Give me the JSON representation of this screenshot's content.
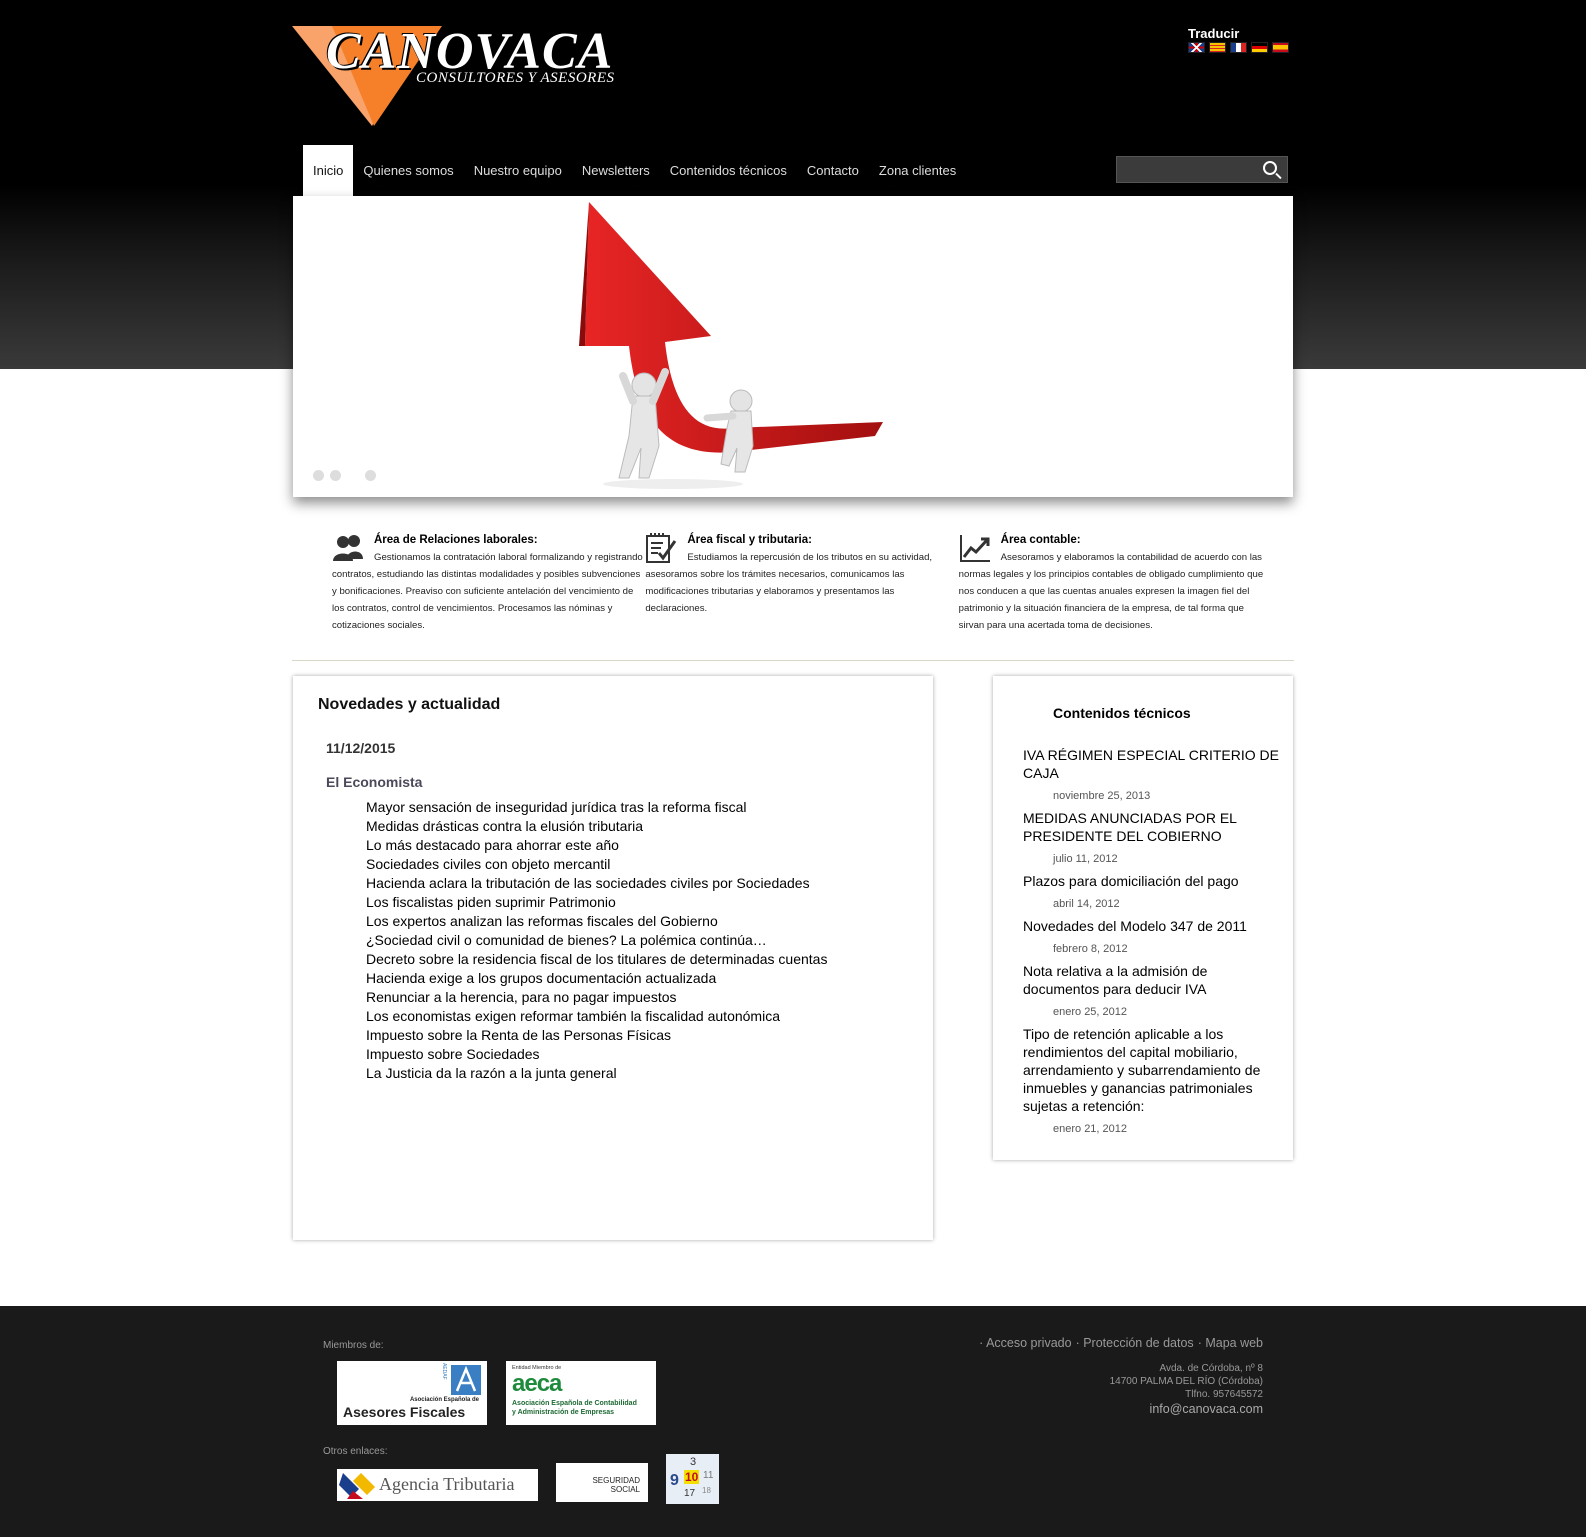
{
  "brand": {
    "name": "CANOVACA",
    "tagline": "CONSULTORES Y ASESORES",
    "accent": "#f6802a"
  },
  "translate": {
    "label": "Traducir",
    "flags": [
      "english-flag-icon",
      "catalan-flag-icon",
      "french-flag-icon",
      "german-flag-icon",
      "spanish-flag-icon"
    ]
  },
  "nav": [
    "Inicio",
    "Quienes somos",
    "Nuestro equipo",
    "Newsletters",
    "Contenidos técnicos",
    "Contacto",
    "Zona clientes"
  ],
  "search": {
    "placeholder": "",
    "value": ""
  },
  "slider": {
    "image": "red-rising-arrow-with-figures",
    "arrow_color": "#d11b1b",
    "dots": 3
  },
  "areas": [
    {
      "title": "Área de Relaciones laborales:",
      "icon": "people-icon",
      "text": "Gestionamos la contratación laboral formalizando y registrando contratos, estudiando las distintas modalidades y posibles subvenciones y bonificaciones. Preaviso con suficiente antelación del vencimiento de los contratos, control de vencimientos. Procesamos las nóminas y cotizaciones sociales."
    },
    {
      "title": "Área fiscal y tributaria:",
      "icon": "checklist-icon",
      "text": "Estudiamos la repercusión de los tributos en su actividad, asesoramos sobre los trámites necesarios, comunicamos las modificaciones tributarias y elaboramos y presentamos las declaraciones."
    },
    {
      "title": "Área contable:",
      "icon": "growth-chart-icon",
      "text": "Asesoramos y elaboramos la contabilidad de acuerdo con las normas legales y los principios contables de obligado cumplimiento que nos conducen a que las cuentas anuales expresen la imagen fiel del patrimonio y la situación financiera de la empresa, de tal forma que sirvan para una acertada toma de decisiones."
    }
  ],
  "news": {
    "title": "Novedades y actualidad",
    "date": "11/12/2015",
    "source": "El Economista",
    "items": [
      "Mayor sensación de inseguridad jurídica tras la reforma fiscal",
      "Medidas drásticas contra la elusión tributaria",
      "Lo más destacado para ahorrar este año",
      "Sociedades civiles con objeto mercantil",
      "Hacienda aclara la tributación de las sociedades civiles por Sociedades",
      "Los fiscalistas piden suprimir Patrimonio",
      "Los expertos analizan las reformas fiscales del Gobierno",
      "¿Sociedad civil o comunidad de bienes? La polémica continúa…",
      "Decreto sobre la residencia fiscal de los titulares de determinadas cuentas",
      "Hacienda exige a los grupos documentación actualizada",
      "Renunciar a la herencia, para no pagar impuestos",
      "Los economistas exigen reformar también la fiscalidad autonómica",
      "Impuesto sobre la Renta de las Personas Físicas",
      "Impuesto sobre Sociedades",
      "La Justicia da la razón a la junta general"
    ]
  },
  "technical": {
    "title": "Contenidos técnicos",
    "items": [
      {
        "title": "IVA RÉGIMEN ESPECIAL CRITERIO DE CAJA",
        "date": "noviembre 25, 2013"
      },
      {
        "title": "MEDIDAS ANUNCIADAS POR EL PRESIDENTE DEL COBIERNO",
        "date": "julio 11, 2012"
      },
      {
        "title": "Plazos para domiciliación del pago",
        "date": "abril 14, 2012"
      },
      {
        "title": "Novedades del Modelo 347 de 2011",
        "date": "febrero 8, 2012"
      },
      {
        "title": "Nota relativa a la admisión de documentos para deducir IVA",
        "date": "enero 25, 2012"
      },
      {
        "title": "Tipo de retención aplicable a los rendimientos del capital mobiliario, arrendamiento y subarrendamiento de inmuebles y ganancias patrimoniales sujetas a retención:",
        "date": "enero 21, 2012"
      }
    ]
  },
  "footer": {
    "members_label": "Miembros de:",
    "other_links_label": "Otros enlaces:",
    "links": [
      "· Acceso privado",
      "· Protección de datos",
      "· Mapa web"
    ],
    "address": [
      "Avda. de Córdoba, nº 8",
      "14700 PALMA DEL RÍO (Córdoba)",
      "Tlfno. 957645572"
    ],
    "email": "info@canovaca.com",
    "aeaf": {
      "acronym": "AEDAF",
      "small": "Asociación Española de",
      "big": "Asesores Fiscales"
    },
    "aeca": {
      "small": "Entidad Miembro de",
      "big": "aeca",
      "line1": "Asociación Española de Contabilidad",
      "line2": "y Administración de Empresas"
    },
    "agencia": "Agencia Tributaria",
    "seguridad": [
      "SEGURIDAD",
      "SOCIAL"
    ],
    "calendar_numbers": [
      "9",
      "10",
      "11",
      "17",
      "18",
      "3"
    ]
  }
}
